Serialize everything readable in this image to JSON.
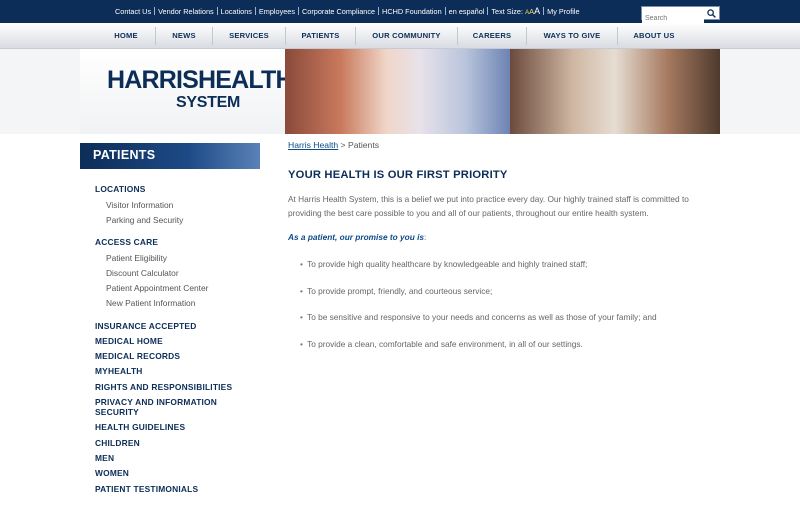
{
  "utility_bar": {
    "links": [
      "Contact Us",
      "Vendor Relations",
      "Locations",
      "Employees",
      "Corporate Compliance",
      "HCHD Foundation",
      "en español"
    ],
    "text_size_label": "Text Size:",
    "text_size_a1": "A",
    "text_size_a2": "A",
    "text_size_a3": "A",
    "my_profile": "My Profile",
    "search_placeholder": "Search"
  },
  "nav": {
    "items": [
      "HOME",
      "NEWS",
      "SERVICES",
      "PATIENTS",
      "OUR COMMUNITY",
      "CAREERS",
      "WAYS TO GIVE",
      "ABOUT US"
    ]
  },
  "logo": {
    "line1": "HARRISHEALTH",
    "line2": "SYSTEM"
  },
  "sidebar": {
    "title": "PATIENTS",
    "locations": "LOCATIONS",
    "visitor_information": "Visitor Information",
    "parking_security": "Parking and Security",
    "access_care": "ACCESS CARE",
    "patient_eligibility": "Patient Eligibility",
    "discount_calculator": "Discount Calculator",
    "appointment_center": "Patient Appointment Center",
    "new_patient_info": "New Patient Information",
    "insurance_accepted": "INSURANCE ACCEPTED",
    "medical_home": "MEDICAL HOME",
    "medical_records": "MEDICAL RECORDS",
    "myhealth": "MYHEALTH",
    "rights": "RIGHTS AND RESPONSIBILITIES",
    "privacy": "PRIVACY AND INFORMATION SECURITY",
    "health_guidelines": "HEALTH GUIDELINES",
    "children": "CHILDREN",
    "men": "MEN",
    "women": "WOMEN",
    "testimonials": "PATIENT TESTIMONIALS"
  },
  "content": {
    "breadcrumb_link": "Harris Health",
    "breadcrumb_sep": ">",
    "breadcrumb_current": "Patients",
    "title": "YOUR HEALTH IS OUR FIRST PRIORITY",
    "intro": "At Harris Health System, this is a belief we put into practice every day. Our highly trained staff is committed to providing the best care possible to you and all of our patients, throughout our entire health system.",
    "promise_label": "As a patient, our promise to you is",
    "promise_colon": ":",
    "bullets": [
      "To provide high quality healthcare by knowledgeable and highly trained staff;",
      "To provide prompt, friendly, and courteous service;",
      "To be sensitive and responsive to your needs and concerns as well as those of your family; and",
      "To provide a clean, comfortable and safe environment, in all of our settings."
    ]
  },
  "colors": {
    "brand_navy": "#0c2d57",
    "link_blue": "#0c4a8a",
    "text_size_accent": "#ffde5b"
  }
}
